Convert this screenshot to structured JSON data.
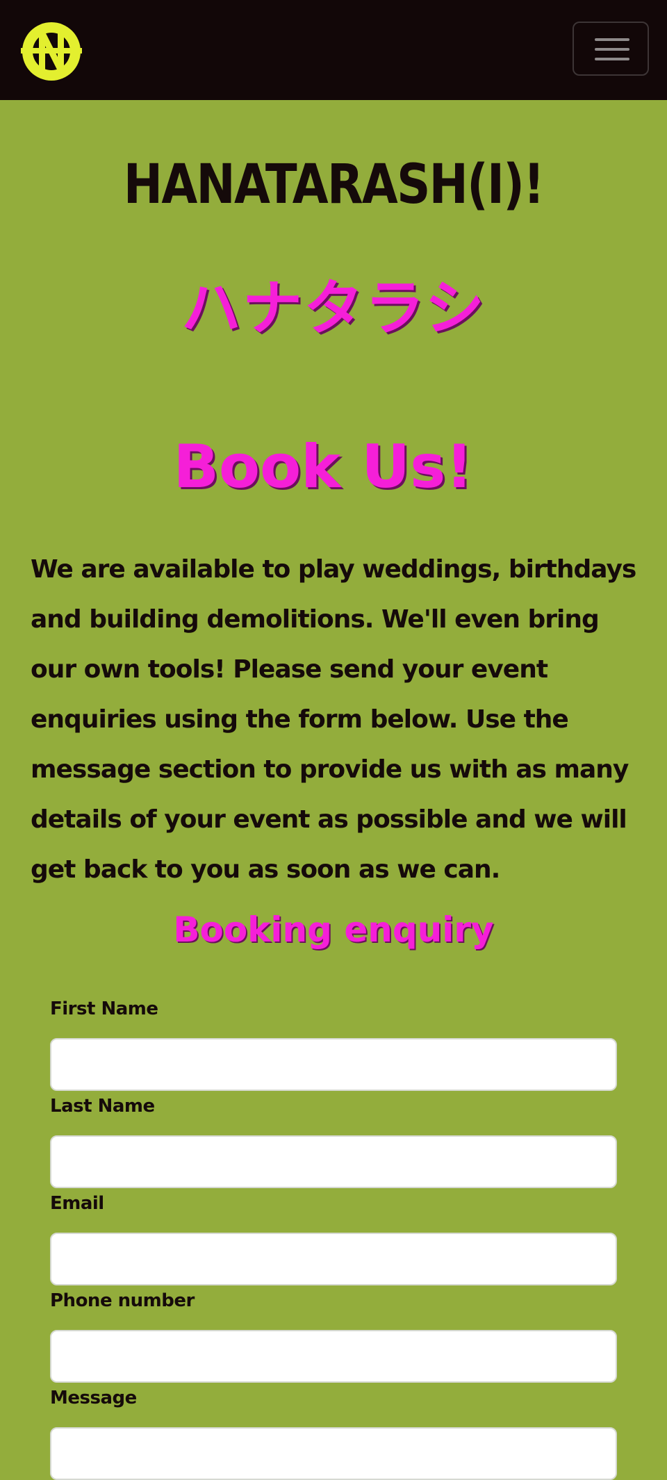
{
  "nav": {
    "logo_letter": "N",
    "brand_color": "#e3ef2f",
    "toggle_icon": "hamburger-icon"
  },
  "header": {
    "title": "HANATARASH(I)!",
    "katakana": "ハナタラシ"
  },
  "section": {
    "title": "Book Us!",
    "intro": "We are available to play weddings, birthdays and building demolitions. We'll even bring our own tools! Please send your event enquiries using the form below. Use the message section to provide us with as many details of your event as possible and we will get back to you as soon as we can."
  },
  "form": {
    "title": "Booking enquiry",
    "first_name_label": "First Name",
    "first_name_value": "",
    "last_name_label": "Last Name",
    "last_name_value": "",
    "email_label": "Email",
    "email_value": "",
    "phone_label": "Phone number",
    "phone_value": "",
    "message_label": "Message",
    "message_value": ""
  },
  "colors": {
    "page_background": "#93ad3c",
    "navbar_background": "#120708",
    "accent_pink": "#f51fd8",
    "text_dark": "#150a0a"
  }
}
